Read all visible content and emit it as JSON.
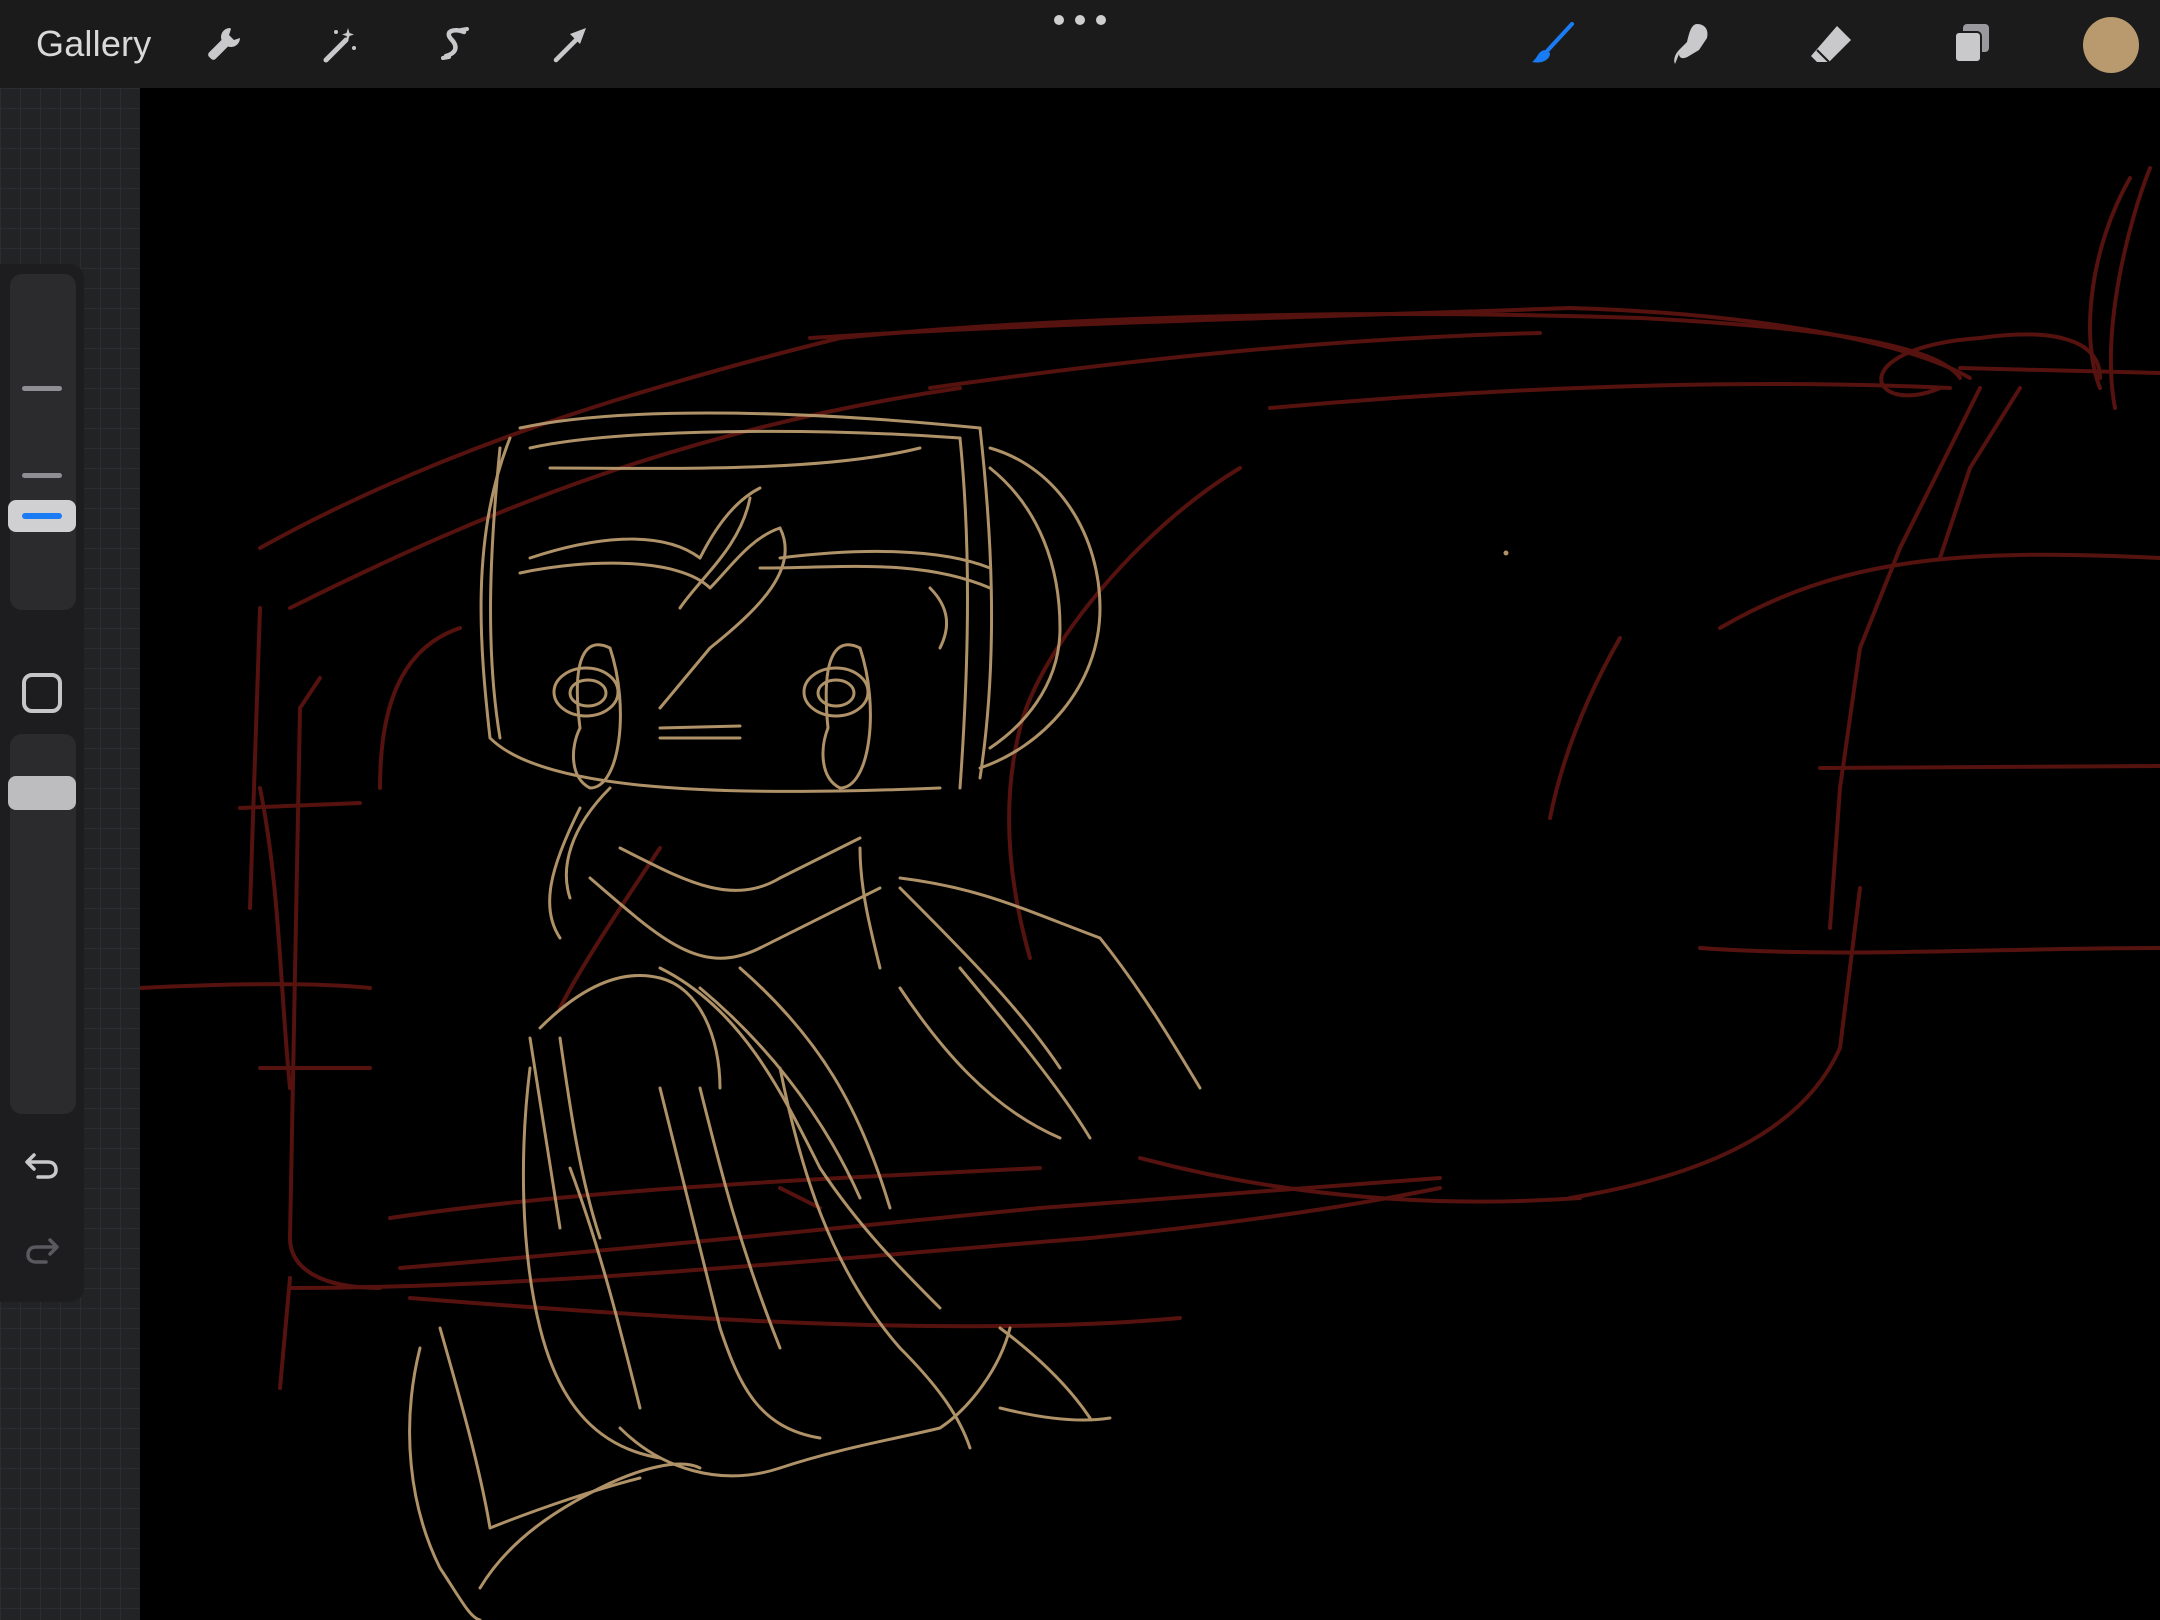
{
  "toolbar": {
    "gallery_label": "Gallery",
    "left_tools": [
      {
        "name": "actions-wrench-icon"
      },
      {
        "name": "adjustments-magic-wand-icon"
      },
      {
        "name": "selection-icon"
      },
      {
        "name": "transform-arrow-icon"
      }
    ],
    "right_tools": [
      {
        "name": "brush-icon",
        "active": true
      },
      {
        "name": "smudge-icon",
        "active": false
      },
      {
        "name": "eraser-icon",
        "active": false
      },
      {
        "name": "layers-icon",
        "active": false
      }
    ],
    "current_color": "#b89a6e",
    "active_tool_color": "#1a7cf5"
  },
  "sidebar": {
    "brush_size_level": 0.3,
    "brush_opacity_level": 0.95
  },
  "canvas": {
    "sketch_colors": {
      "rough_layer": "#5a1410",
      "lineart_layer": "#b99a6e"
    }
  }
}
